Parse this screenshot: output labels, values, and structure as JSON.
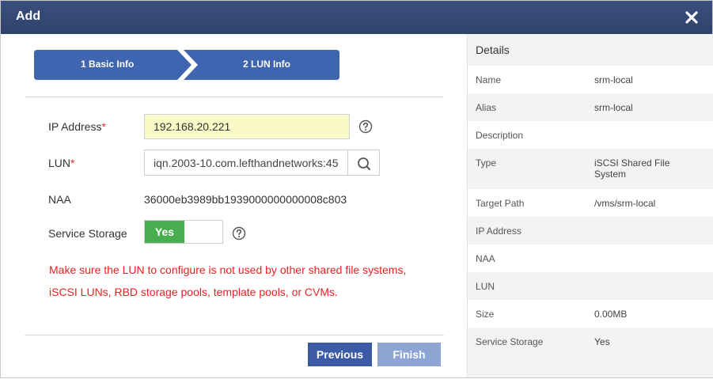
{
  "dialog": {
    "title": "Add",
    "close_icon": "close-icon"
  },
  "steps": [
    {
      "label": "1 Basic Info"
    },
    {
      "label": "2 LUN Info"
    }
  ],
  "form": {
    "ip_label": "IP Address",
    "ip_value": "192.168.20.221",
    "lun_label": "LUN",
    "lun_value": "iqn.2003-10.com.lefthandnetworks:45",
    "naa_label": "NAA",
    "naa_value": "36000eb3989bb1939000000000008c803",
    "service_storage_label": "Service Storage",
    "service_storage_toggle": "Yes",
    "required_mark": "*",
    "warning_line1": "Make sure the LUN to configure is not used by other shared file systems,",
    "warning_line2": "iSCSI LUNs, RBD storage pools, template pools, or CVMs."
  },
  "buttons": {
    "previous": "Previous",
    "finish": "Finish"
  },
  "details": {
    "title": "Details",
    "rows": [
      {
        "key": "Name",
        "value": "srm-local"
      },
      {
        "key": "Alias",
        "value": "srm-local"
      },
      {
        "key": "Description",
        "value": ""
      },
      {
        "key": "Type",
        "value": "iSCSI Shared File System"
      },
      {
        "key": "Target Path",
        "value": "/vms/srm-local"
      },
      {
        "key": "IP Address",
        "value": ""
      },
      {
        "key": "NAA",
        "value": ""
      },
      {
        "key": "LUN",
        "value": ""
      },
      {
        "key": "Size",
        "value": "0.00MB"
      },
      {
        "key": "Service Storage",
        "value": "Yes"
      }
    ]
  },
  "colors": {
    "titlebar": "#34487a",
    "step_bg": "#3f64b0",
    "toggle_on": "#48ad4e",
    "warning_text": "#e52222",
    "primary_button": "#3b5ba6",
    "disabled_button": "#8ca5d3",
    "ip_input_bg": "#fafac8"
  }
}
